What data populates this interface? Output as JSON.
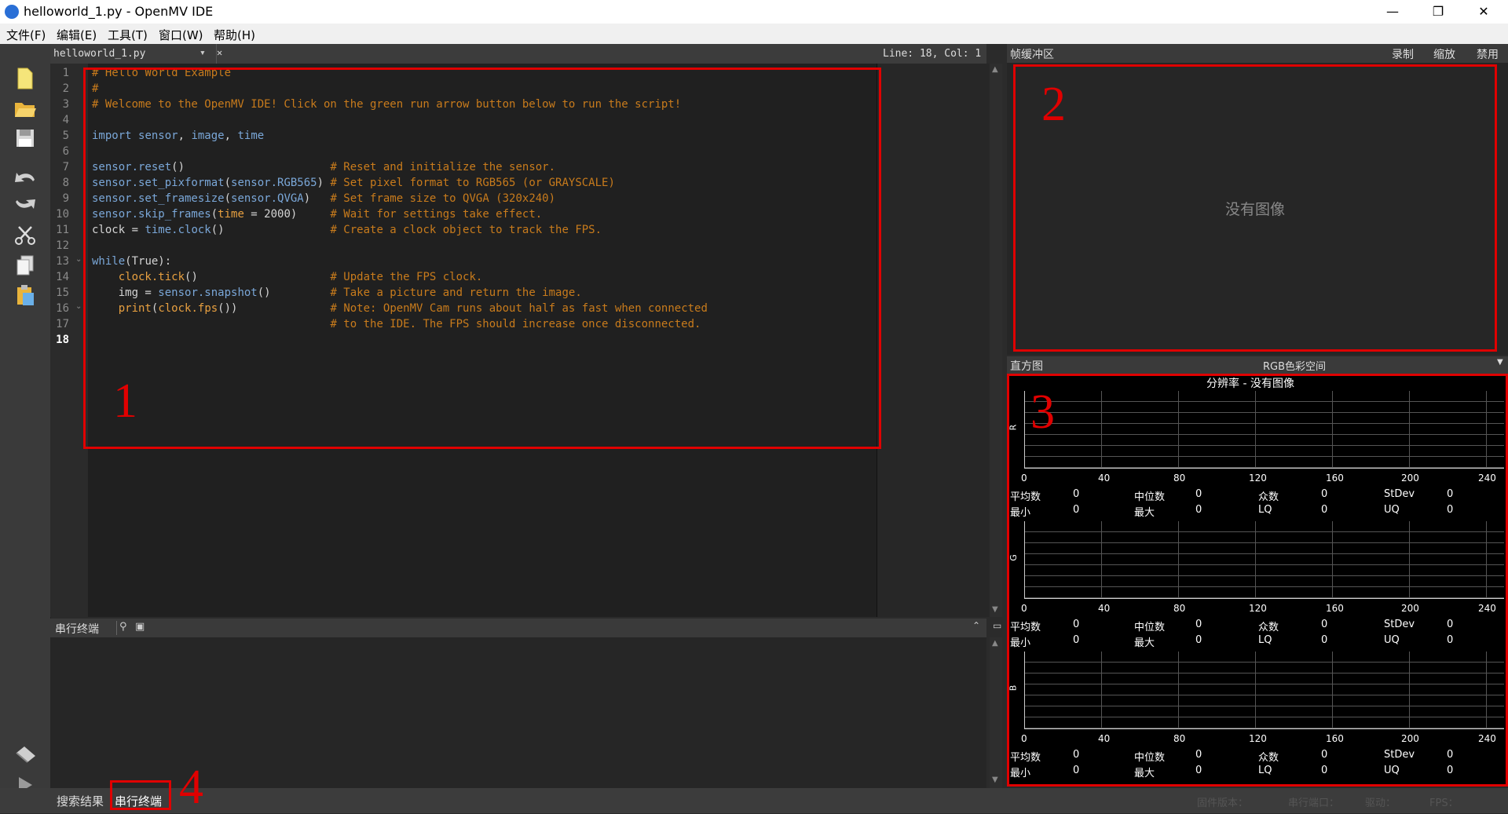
{
  "window": {
    "title": "helloworld_1.py - OpenMV IDE",
    "minimize": "—",
    "maximize": "❐",
    "close": "✕"
  },
  "menu": [
    "文件(F)",
    "编辑(E)",
    "工具(T)",
    "窗口(W)",
    "帮助(H)"
  ],
  "editor": {
    "tab_name": "helloworld_1.py",
    "tab_dropdown": "▾",
    "tab_close": "✕",
    "cursor_pos": "Line: 18, Col: 1",
    "line_numbers": [
      "1",
      "2",
      "3",
      "4",
      "5",
      "6",
      "7",
      "8",
      "9",
      "10",
      "11",
      "12",
      "13",
      "14",
      "15",
      "16",
      "17",
      "18"
    ]
  },
  "serial": {
    "title": "串行终端"
  },
  "framebuffer": {
    "title": "帧缓冲区",
    "btn_record": "录制",
    "btn_zoom": "缩放",
    "btn_disable": "禁用",
    "no_image": "没有图像"
  },
  "histogram": {
    "title": "直方图",
    "colorspace": "RGB色彩空间",
    "resolution": "分辨率 - 没有图像",
    "channels": [
      "R",
      "G",
      "B"
    ],
    "ticks": [
      "0",
      "40",
      "80",
      "120",
      "160",
      "200",
      "240"
    ],
    "stat_labels": {
      "mean": "平均数",
      "median": "中位数",
      "mode": "众数",
      "stdev": "StDev",
      "min": "最小",
      "max": "最大",
      "lq": "LQ",
      "uq": "UQ"
    },
    "stat_value": "0"
  },
  "bottom": {
    "tab_search": "搜索结果",
    "tab_serial": "串行终端"
  },
  "status": {
    "firmware": "固件版本：",
    "port": "串行端口：",
    "drive": "驱动：",
    "fps": "FPS："
  },
  "annotations": [
    "1",
    "2",
    "3",
    "4"
  ],
  "colors": {
    "annotation": "#e00000",
    "comment": "#c87b1c",
    "keyword": "#7aa7d8"
  }
}
